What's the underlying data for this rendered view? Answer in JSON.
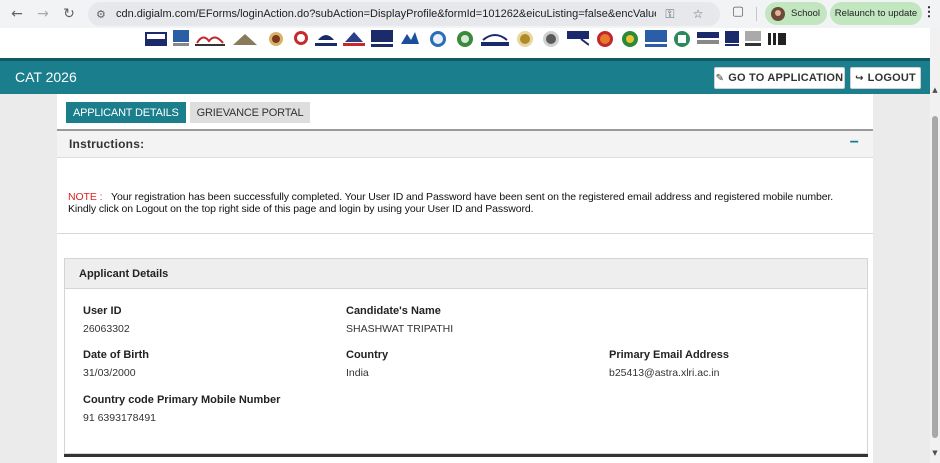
{
  "browser": {
    "url": "cdn.digialm.com/EForms/loginAction.do?subAction=DisplayProfile&formId=101262&eicuListing=false&encValues=hQ...",
    "profile_label": "School",
    "relaunch_label": "Relaunch to update",
    "icons": [
      "back-icon",
      "forward-icon",
      "reload-icon",
      "site-info-icon",
      "password-key-icon",
      "bookmark-star-icon",
      "extensions-icon",
      "menu-icon"
    ]
  },
  "header": {
    "title": "CAT 2026",
    "go_to_application": "GO TO APPLICATION",
    "logout": "LOGOUT",
    "color": "#1a7e8c"
  },
  "tabs": [
    {
      "label": "APPLICANT DETAILS",
      "active": true
    },
    {
      "label": "GRIEVANCE PORTAL",
      "active": false
    }
  ],
  "instructions": {
    "title": "Instructions:",
    "collapse_symbol": "−",
    "note_label": "NOTE :",
    "note_text": "Your registration has been successfully completed. Your User ID and Password have been sent on the registered email address and registered mobile number. Kindly click on Logout on the top right side of this page and login by using your User ID and Password."
  },
  "applicant": {
    "section_title": "Applicant Details",
    "user_id": {
      "label": "User ID",
      "value": "26063302"
    },
    "name": {
      "label": "Candidate's Name",
      "value": "SHASHWAT TRIPATHI"
    },
    "dob": {
      "label": "Date of Birth",
      "value": "31/03/2000"
    },
    "country": {
      "label": "Country",
      "value": "India"
    },
    "email": {
      "label": "Primary Email Address",
      "value": "b25413@astra.xlri.ac.in"
    },
    "mobile": {
      "label": "Country code Primary Mobile Number",
      "value": "91 6393178491"
    }
  }
}
